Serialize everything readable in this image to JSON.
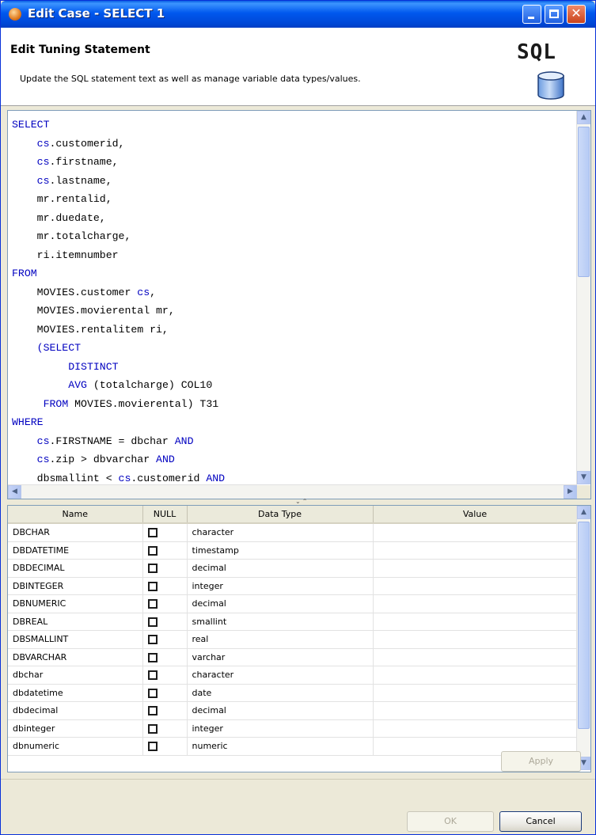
{
  "window": {
    "title": "Edit Case - SELECT 1"
  },
  "header": {
    "title": "Edit Tuning Statement",
    "description": "Update the SQL statement text as well as manage variable data types/values.",
    "logo_text": "SQL"
  },
  "editor": {
    "lines": [
      [
        {
          "t": "SELECT",
          "c": "kw"
        }
      ],
      [
        {
          "t": "    "
        },
        {
          "t": "cs",
          "c": "al"
        },
        {
          "t": ".customerid,"
        }
      ],
      [
        {
          "t": "    "
        },
        {
          "t": "cs",
          "c": "al"
        },
        {
          "t": ".firstname,"
        }
      ],
      [
        {
          "t": "    "
        },
        {
          "t": "cs",
          "c": "al"
        },
        {
          "t": ".lastname,"
        }
      ],
      [
        {
          "t": "    mr.rentalid,"
        }
      ],
      [
        {
          "t": "    mr.duedate,"
        }
      ],
      [
        {
          "t": "    mr.totalcharge,"
        }
      ],
      [
        {
          "t": "    ri.itemnumber"
        }
      ],
      [
        {
          "t": "FROM",
          "c": "kw"
        }
      ],
      [
        {
          "t": "    MOVIES.customer "
        },
        {
          "t": "cs",
          "c": "al"
        },
        {
          "t": ","
        }
      ],
      [
        {
          "t": "    MOVIES.movierental mr,"
        }
      ],
      [
        {
          "t": "    MOVIES.rentalitem ri,"
        }
      ],
      [
        {
          "t": "    "
        },
        {
          "t": "(SELECT",
          "c": "kw"
        }
      ],
      [
        {
          "t": "         "
        },
        {
          "t": "DISTINCT",
          "c": "kw"
        }
      ],
      [
        {
          "t": "         "
        },
        {
          "t": "AVG",
          "c": "kw"
        },
        {
          "t": " (totalcharge) COL10"
        }
      ],
      [
        {
          "t": "     "
        },
        {
          "t": "FROM",
          "c": "kw"
        },
        {
          "t": " MOVIES.movierental) T31"
        }
      ],
      [
        {
          "t": "WHERE",
          "c": "kw"
        }
      ],
      [
        {
          "t": "    "
        },
        {
          "t": "cs",
          "c": "al"
        },
        {
          "t": ".FIRSTNAME = dbchar "
        },
        {
          "t": "AND",
          "c": "kw"
        }
      ],
      [
        {
          "t": "    "
        },
        {
          "t": "cs",
          "c": "al"
        },
        {
          "t": ".zip > dbvarchar "
        },
        {
          "t": "AND",
          "c": "kw"
        }
      ],
      [
        {
          "t": "    dbsmallint < "
        },
        {
          "t": "cs",
          "c": "al"
        },
        {
          "t": ".customerid "
        },
        {
          "t": "AND",
          "c": "kw"
        }
      ]
    ]
  },
  "table": {
    "columns": [
      "Name",
      "NULL",
      "Data Type",
      "Value"
    ],
    "rows": [
      {
        "name": "DBCHAR",
        "type": "character",
        "value": ""
      },
      {
        "name": "DBDATETIME",
        "type": "timestamp",
        "value": ""
      },
      {
        "name": "DBDECIMAL",
        "type": "decimal",
        "value": ""
      },
      {
        "name": "DBINTEGER",
        "type": "integer",
        "value": ""
      },
      {
        "name": "DBNUMERIC",
        "type": "decimal",
        "value": ""
      },
      {
        "name": "DBREAL",
        "type": "smallint",
        "value": ""
      },
      {
        "name": "DBSMALLINT",
        "type": "real",
        "value": ""
      },
      {
        "name": "DBVARCHAR",
        "type": "varchar",
        "value": ""
      },
      {
        "name": "dbchar",
        "type": "character",
        "value": ""
      },
      {
        "name": "dbdatetime",
        "type": "date",
        "value": ""
      },
      {
        "name": "dbdecimal",
        "type": "decimal",
        "value": ""
      },
      {
        "name": "dbinteger",
        "type": "integer",
        "value": ""
      },
      {
        "name": "dbnumeric",
        "type": "numeric",
        "value": ""
      }
    ]
  },
  "buttons": {
    "apply": "Apply",
    "ok": "OK",
    "cancel": "Cancel"
  }
}
